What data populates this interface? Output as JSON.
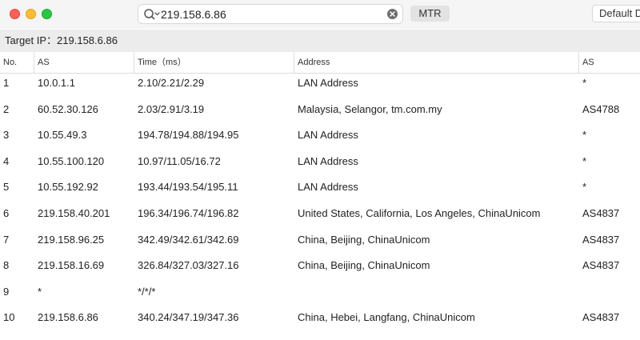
{
  "toolbar": {
    "search_value": "219.158.6.86",
    "mtr_label": "MTR",
    "profile_value": "Default D"
  },
  "target": {
    "label": "Target IP：",
    "value": "219.158.6.86"
  },
  "table": {
    "headers": {
      "no": "No.",
      "ip": "AS",
      "time": "Time（ms）",
      "address": "Address",
      "as": "AS"
    },
    "rows": [
      {
        "no": "1",
        "ip": "10.0.1.1",
        "time": "2.10/2.21/2.29",
        "address": "LAN Address",
        "as": "*"
      },
      {
        "no": "2",
        "ip": "60.52.30.126",
        "time": "2.03/2.91/3.19",
        "address": "Malaysia, Selangor, tm.com.my",
        "as": "AS4788"
      },
      {
        "no": "3",
        "ip": "10.55.49.3",
        "time": "194.78/194.88/194.95",
        "address": "LAN Address",
        "as": "*"
      },
      {
        "no": "4",
        "ip": "10.55.100.120",
        "time": "10.97/11.05/16.72",
        "address": "LAN Address",
        "as": "*"
      },
      {
        "no": "5",
        "ip": "10.55.192.92",
        "time": "193.44/193.54/195.11",
        "address": "LAN Address",
        "as": "*"
      },
      {
        "no": "6",
        "ip": "219.158.40.201",
        "time": "196.34/196.74/196.82",
        "address": "United States, California, Los Angeles, ChinaUnicom",
        "as": "AS4837"
      },
      {
        "no": "7",
        "ip": "219.158.96.25",
        "time": "342.49/342.61/342.69",
        "address": "China, Beijing, ChinaUnicom",
        "as": "AS4837"
      },
      {
        "no": "8",
        "ip": "219.158.16.69",
        "time": "326.84/327.03/327.16",
        "address": "China, Beijing, ChinaUnicom",
        "as": "AS4837"
      },
      {
        "no": "9",
        "ip": "*",
        "time": "*/*/*",
        "address": "",
        "as": ""
      },
      {
        "no": "10",
        "ip": "219.158.6.86",
        "time": "340.24/347.19/347.36",
        "address": "China, Hebei, Langfang, ChinaUnicom",
        "as": "AS4837"
      }
    ]
  },
  "icons": {
    "search": "search-icon",
    "clear": "clear-icon"
  },
  "colors": {
    "close": "#ff5f57",
    "minimize": "#febc2e",
    "zoom": "#28c840"
  }
}
